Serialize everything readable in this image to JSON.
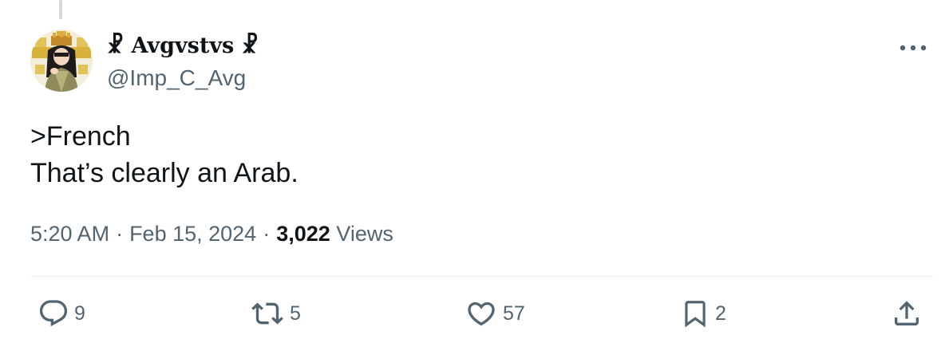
{
  "tweet": {
    "display_name": "☧ Avgvstvs ☧",
    "handle": "@Imp_C_Avg",
    "text_lines": [
      ">French",
      "That’s clearly an Arab."
    ],
    "time": "5:20 AM",
    "date": "Feb 15, 2024",
    "separator": "·",
    "views_count": "3,022",
    "views_label": "Views"
  },
  "actions": {
    "replies": "9",
    "reposts": "5",
    "likes": "57",
    "bookmarks": "2"
  },
  "icons": {
    "more": "more-dots-icon",
    "reply": "reply-bubble-icon",
    "repost": "repost-arrows-icon",
    "like": "heart-icon",
    "bookmark": "bookmark-icon",
    "share": "share-upload-icon"
  },
  "colors": {
    "text_primary": "#0f1419",
    "text_secondary": "#536471",
    "divider": "#eff3f4",
    "thread_line": "#cfd9de"
  }
}
